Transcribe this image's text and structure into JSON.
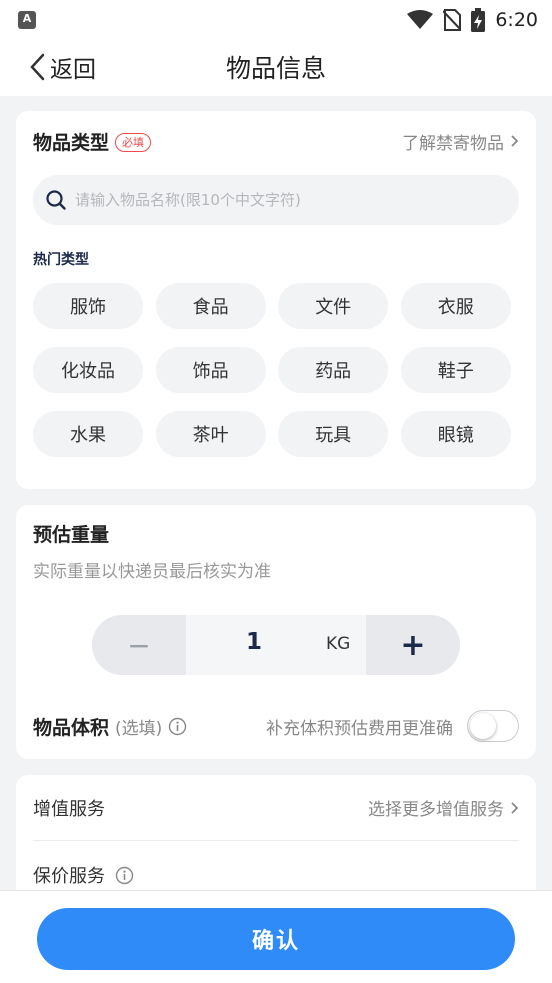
{
  "status_bar": {
    "time": "6:20",
    "left_badge": "A"
  },
  "nav": {
    "back_label": "返回",
    "title": "物品信息"
  },
  "item_type": {
    "title": "物品类型",
    "required_badge": "必填",
    "learn_link": "了解禁寄物品",
    "search_placeholder": "请输入物品名称(限10个中文字符)",
    "hot_label": "热门类型",
    "chips": [
      "服饰",
      "食品",
      "文件",
      "衣服",
      "化妆品",
      "饰品",
      "药品",
      "鞋子",
      "水果",
      "茶叶",
      "玩具",
      "眼镜"
    ]
  },
  "weight": {
    "title": "预估重量",
    "subtitle": "实际重量以快递员最后核实为准",
    "minus": "−",
    "plus": "+",
    "value": "1",
    "unit": "KG"
  },
  "volume": {
    "title": "物品体积",
    "optional": "(选填)",
    "hint": "补充体积预估费用更准确",
    "toggle_on": false
  },
  "services": {
    "value_added_label": "增值服务",
    "value_added_link": "选择更多增值服务",
    "insurance_label": "保价服务"
  },
  "confirm_label": "确认",
  "colors": {
    "primary": "#2e8bf7",
    "required": "#f04a4a",
    "page_bg": "#f2f3f5"
  }
}
